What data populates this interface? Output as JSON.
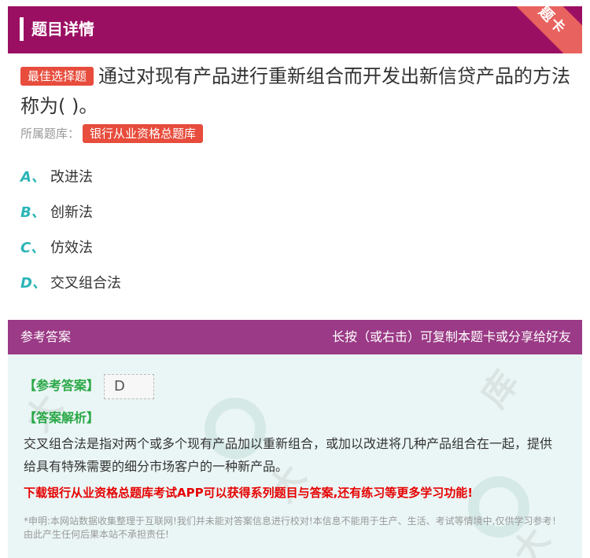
{
  "header": {
    "title": "题目详情",
    "ribbon": "题卡"
  },
  "question": {
    "type_tag": "最佳选择题",
    "text": "通过对现有产品进行重新组合而开发出新信贷产品的方法称为( )。",
    "bank_label": "所属题库：",
    "bank_name": "银行从业资格总题库"
  },
  "options": [
    {
      "letter": "A、",
      "text": "改进法"
    },
    {
      "letter": "B、",
      "text": "创新法"
    },
    {
      "letter": "C、",
      "text": "仿效法"
    },
    {
      "letter": "D、",
      "text": "交叉组合法"
    }
  ],
  "answer": {
    "section_title": "参考答案",
    "hint": "长按（或右击）可复制本题卡或分享给好友",
    "ref_label": "【参考答案】",
    "ref_value": "D",
    "analysis_label": "【答案解析】",
    "analysis_text": "交叉组合法是指对两个或多个现有产品加以重新组合，或加以改进将几种产品组合在一起，提供给具有特殊需要的细分市场客户的一种新产品。",
    "promo": "下载银行从业资格总题库考试APP可以获得系列题目与答案,还有练习等更多学习功能!",
    "disclaimer": "*申明:本网站数据收集整理于互联网!我们并未能对答案信息进行校对!本信息不能用于生产、生活、考试等情境中,仅供学习参考！由此产生任何后果本站不承担责任!"
  },
  "colors": {
    "header": "#9b0f63",
    "answer_header": "#9b3a86",
    "tag": "#e74c3c",
    "option_letter": "#2bb5b8",
    "label_green": "#2aa846",
    "promo": "#e60000"
  }
}
